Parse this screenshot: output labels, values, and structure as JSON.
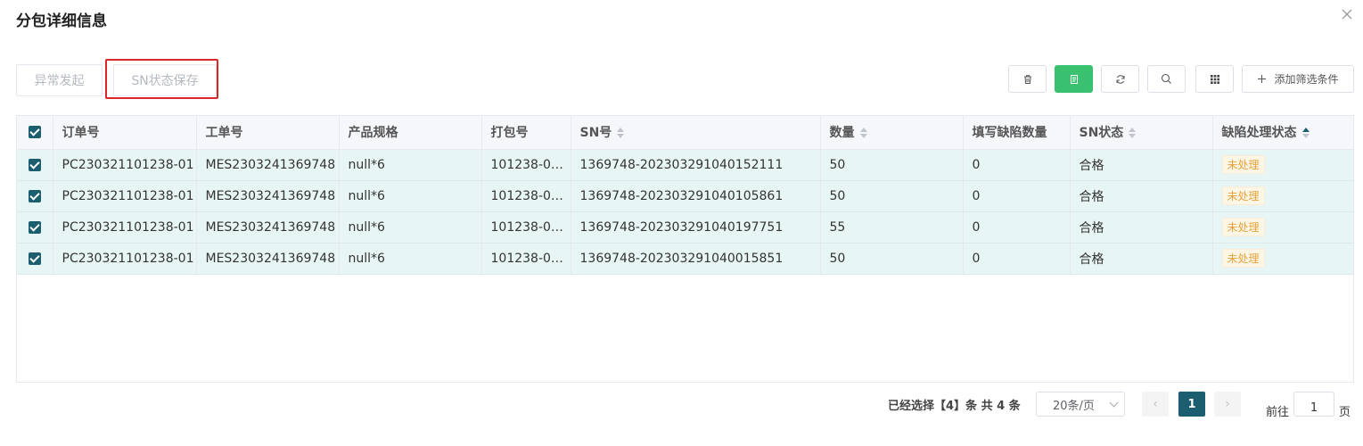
{
  "dialog": {
    "title": "分包详细信息"
  },
  "actions": {
    "abnormal": "异常发起",
    "sn_save": "SN状态保存"
  },
  "toolbar": {
    "filter_label": "添加筛选条件"
  },
  "table": {
    "columns": [
      "订单号",
      "工单号",
      "产品规格",
      "打包号",
      "SN号",
      "数量",
      "填写缺陷数量",
      "SN状态",
      "缺陷处理状态"
    ],
    "rows": [
      [
        "PC230321101238-01",
        "MES2303241369748",
        "null*6",
        "101238-0…",
        "1369748-202303291040152111",
        "50",
        "0",
        "合格",
        "未处理"
      ],
      [
        "PC230321101238-01",
        "MES2303241369748",
        "null*6",
        "101238-0…",
        "1369748-202303291040105861",
        "50",
        "0",
        "合格",
        "未处理"
      ],
      [
        "PC230321101238-01",
        "MES2303241369748",
        "null*6",
        "101238-0…",
        "1369748-202303291040197751",
        "55",
        "0",
        "合格",
        "未处理"
      ],
      [
        "PC230321101238-01",
        "MES2303241369748",
        "null*6",
        "101238-0…",
        "1369748-202303291040015851",
        "50",
        "0",
        "合格",
        "未处理"
      ]
    ]
  },
  "pagination": {
    "info": "已经选择【4】条  共 4 条",
    "page_size": "20条/页",
    "current_page": "1",
    "goto_label": "前往",
    "goto_value": "1",
    "page_suffix": "页"
  },
  "colors": {
    "primary": "#1b5e6f",
    "green": "#3ac16f",
    "highlight": "#d9262b",
    "row_bg": "#e8f5f5"
  }
}
